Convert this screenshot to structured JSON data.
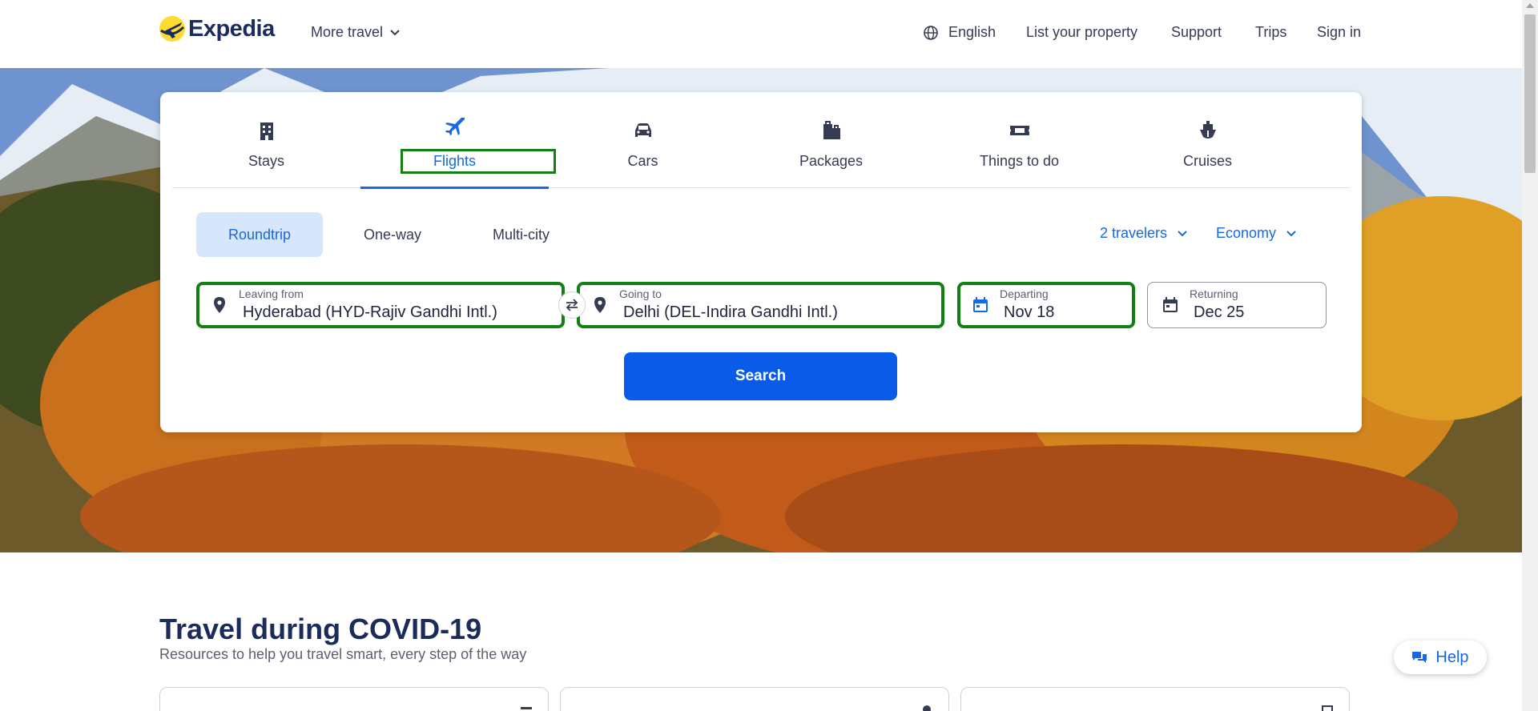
{
  "header": {
    "logo_text": "Expedia",
    "more_travel": "More travel",
    "language": "English",
    "list_property": "List your property",
    "support": "Support",
    "trips": "Trips",
    "sign_in": "Sign in"
  },
  "tabs": [
    {
      "label": "Stays",
      "icon": "building-icon"
    },
    {
      "label": "Flights",
      "icon": "plane-icon",
      "active": true
    },
    {
      "label": "Cars",
      "icon": "car-icon"
    },
    {
      "label": "Packages",
      "icon": "luggage-icon"
    },
    {
      "label": "Things to do",
      "icon": "ticket-icon"
    },
    {
      "label": "Cruises",
      "icon": "ship-icon"
    }
  ],
  "trip_types": {
    "roundtrip": "Roundtrip",
    "oneway": "One-way",
    "multicity": "Multi-city",
    "selected": "Roundtrip"
  },
  "travelers": "2 travelers",
  "cabin_class": "Economy",
  "fields": {
    "leaving_from": {
      "label": "Leaving from",
      "value": "Hyderabad (HYD-Rajiv Gandhi Intl.)"
    },
    "going_to": {
      "label": "Going to",
      "value": "Delhi (DEL-Indira Gandhi Intl.)"
    },
    "departing": {
      "label": "Departing",
      "value": "Nov 18"
    },
    "returning": {
      "label": "Returning",
      "value": "Dec 25"
    }
  },
  "search_label": "Search",
  "covid": {
    "title": "Travel during COVID-19",
    "subtitle": "Resources to help you travel smart, every step of the way"
  },
  "help_label": "Help",
  "colors": {
    "accent": "#1668e3",
    "search_button": "#0a5ce8",
    "highlight": "#128012",
    "brand_navy": "#1b2b5b",
    "logo_yellow": "#fddb32"
  }
}
